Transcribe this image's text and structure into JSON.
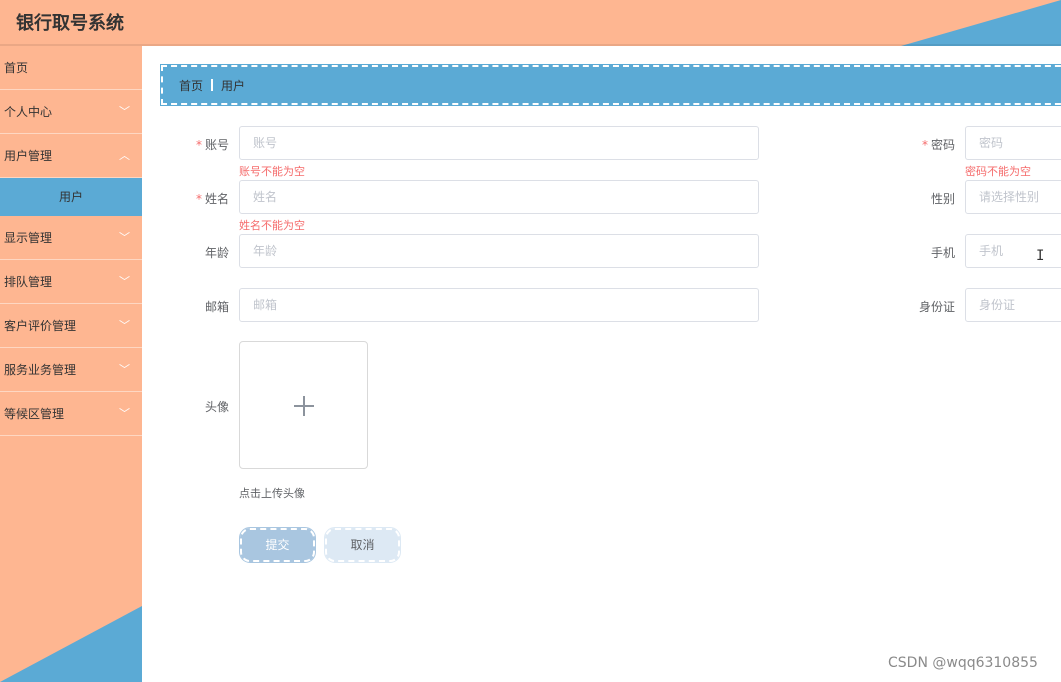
{
  "app": {
    "title": "银行取号系统"
  },
  "sidebar": {
    "items": [
      {
        "label": "首页"
      },
      {
        "label": "个人中心"
      },
      {
        "label": "用户管理"
      },
      {
        "label": "显示管理"
      },
      {
        "label": "排队管理"
      },
      {
        "label": "客户评价管理"
      },
      {
        "label": "服务业务管理"
      },
      {
        "label": "等候区管理"
      }
    ],
    "active_sub": "用户"
  },
  "breadcrumb": {
    "home": "首页",
    "current": "用户"
  },
  "form": {
    "account": {
      "label": "账号",
      "placeholder": "账号",
      "error": "账号不能为空"
    },
    "password": {
      "label": "密码",
      "placeholder": "密码",
      "error": "密码不能为空"
    },
    "name": {
      "label": "姓名",
      "placeholder": "姓名",
      "error": "姓名不能为空"
    },
    "gender": {
      "label": "性别",
      "placeholder": "请选择性别"
    },
    "age": {
      "label": "年龄",
      "placeholder": "年龄"
    },
    "phone": {
      "label": "手机",
      "placeholder": "手机"
    },
    "email": {
      "label": "邮箱",
      "placeholder": "邮箱"
    },
    "id_card": {
      "label": "身份证",
      "placeholder": "身份证"
    },
    "avatar": {
      "label": "头像",
      "tip": "点击上传头像"
    },
    "required_mark": "*"
  },
  "buttons": {
    "submit": "提交",
    "cancel": "取消"
  },
  "watermark": "CSDN @wqq6310855",
  "icons": {
    "chevron": "chevron-down-icon",
    "plus": "plus-icon",
    "cursor": "text-cursor-icon"
  },
  "colors": {
    "header": "#FEB691",
    "accent": "#5BAAD5",
    "error": "#F56C6C"
  }
}
